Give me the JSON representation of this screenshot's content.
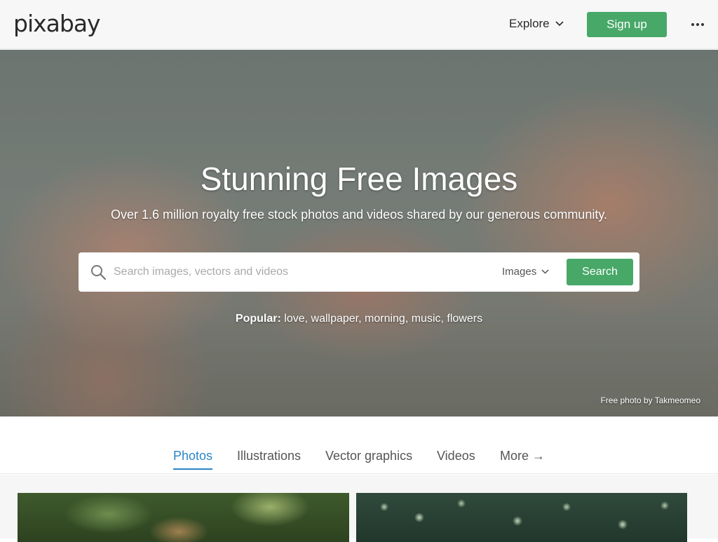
{
  "header": {
    "logo": "pixabay",
    "explore_label": "Explore",
    "signup_label": "Sign up"
  },
  "hero": {
    "title": "Stunning Free Images",
    "subtitle": "Over 1.6 million royalty free stock photos and videos shared by our generous community.",
    "search": {
      "placeholder": "Search images, vectors and videos",
      "value": "",
      "type_selected": "Images",
      "button_label": "Search"
    },
    "popular": {
      "label": "Popular:",
      "terms": [
        "love",
        "wallpaper",
        "morning",
        "music",
        "flowers"
      ]
    },
    "credit": "Free photo by Takmeomeo"
  },
  "tabs": [
    {
      "label": "Photos",
      "active": true
    },
    {
      "label": "Illustrations",
      "active": false
    },
    {
      "label": "Vector graphics",
      "active": false
    },
    {
      "label": "Videos",
      "active": false
    },
    {
      "label": "More →",
      "active": false
    }
  ],
  "colors": {
    "brand_green": "#48a868",
    "tab_active_blue": "#2b84c6",
    "header_bg": "#f7f7f7"
  },
  "icons": [
    "search-icon",
    "chevron-down-icon",
    "more-horizontal-icon"
  ]
}
